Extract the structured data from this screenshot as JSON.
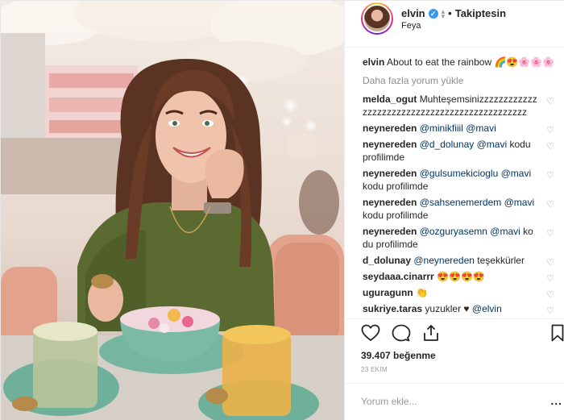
{
  "post": {
    "photo_alt": "",
    "username": "elvin",
    "follow_state": "Takiptesin",
    "location": "Feya",
    "caption_user": "elvin",
    "caption_text": "About to eat the rainbow 🌈😍🌸🌸🌸",
    "load_more": "Daha fazla yorum yükle",
    "comments": [
      {
        "user": "melda_ogut",
        "text": "Muhteşemsinizzzzzzzzzzzzzzzzzzzzzzzzzzzzzzzzzzzzzzzzzzzzzz"
      },
      {
        "user": "neynereden",
        "mention1": "@minikfiiil",
        "mention2": "@mavi",
        "text": ""
      },
      {
        "user": "neynereden",
        "mention1": "@d_dolunay",
        "mention2": "@mavi",
        "text": "kodu profilimde"
      },
      {
        "user": "neynereden",
        "mention1": "@gulsumekicioglu",
        "mention2": "@mavi",
        "text": "kodu profilimde"
      },
      {
        "user": "neynereden",
        "mention1": "@sahsenemerdem",
        "mention2": "@mavi",
        "text": "kodu profilimde"
      },
      {
        "user": "neynereden",
        "mention1": "@ozguryasemn",
        "mention2": "@mavi",
        "text": "kodu profilimde"
      },
      {
        "user": "d_dolunay",
        "mention1": "@neynereden",
        "text": "teşekkürler"
      },
      {
        "user": "seydaaa.cinarrr",
        "text": "😍😍😍😍"
      },
      {
        "user": "uguragunn",
        "text": "👏"
      },
      {
        "user": "sukriye.taras",
        "text": "yuzukler ♥",
        "mention1": "@elvin"
      }
    ],
    "likes": "39.407 beğenme",
    "date": "23 EKİM",
    "comment_placeholder": "Yorum ekle...",
    "more_label": "..."
  },
  "colors": {
    "link": "#003569",
    "muted": "#8e8e8e",
    "verified": "#3897f0"
  },
  "icons": {
    "like": "heart-icon",
    "comment": "comment-bubble-icon",
    "share": "share-icon",
    "save": "bookmark-icon",
    "comment_like": "heart-icon"
  }
}
